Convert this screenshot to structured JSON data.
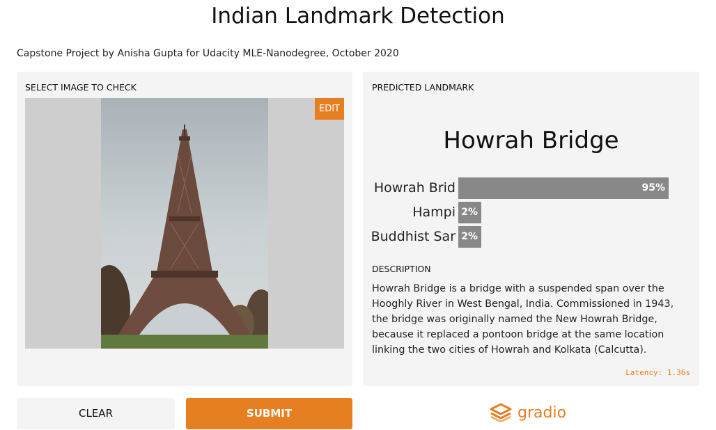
{
  "header": {
    "title": "Indian Landmark Detection",
    "subtitle": "Capstone Project by Anisha Gupta for Udacity MLE-Nanodegree, October 2020"
  },
  "input_panel": {
    "label": "SELECT IMAGE TO CHECK",
    "edit_label": "EDIT"
  },
  "output_panel": {
    "label": "PREDICTED LANDMARK",
    "prediction": "Howrah Bridge",
    "confidences": [
      {
        "label": "Howrah Brid",
        "value_text": "95%",
        "fraction": 0.95
      },
      {
        "label": "Hampi",
        "value_text": "2%",
        "fraction": 0.02
      },
      {
        "label": "Buddhist Sar",
        "value_text": "2%",
        "fraction": 0.02
      }
    ],
    "description_label": "DESCRIPTION",
    "description": "Howrah Bridge is a bridge with a suspended span over the Hooghly River in West Bengal, India. Commissioned in 1943, the bridge was originally named the New Howrah Bridge, because it replaced a pontoon bridge at the same location linking the two cities of Howrah and Kolkata (Calcutta).",
    "latency": "Latency: 1.36s"
  },
  "actions": {
    "clear_label": "CLEAR",
    "submit_label": "SUBMIT"
  },
  "branding": {
    "logo_text": "gradio",
    "accent_color": "#e67e22"
  }
}
